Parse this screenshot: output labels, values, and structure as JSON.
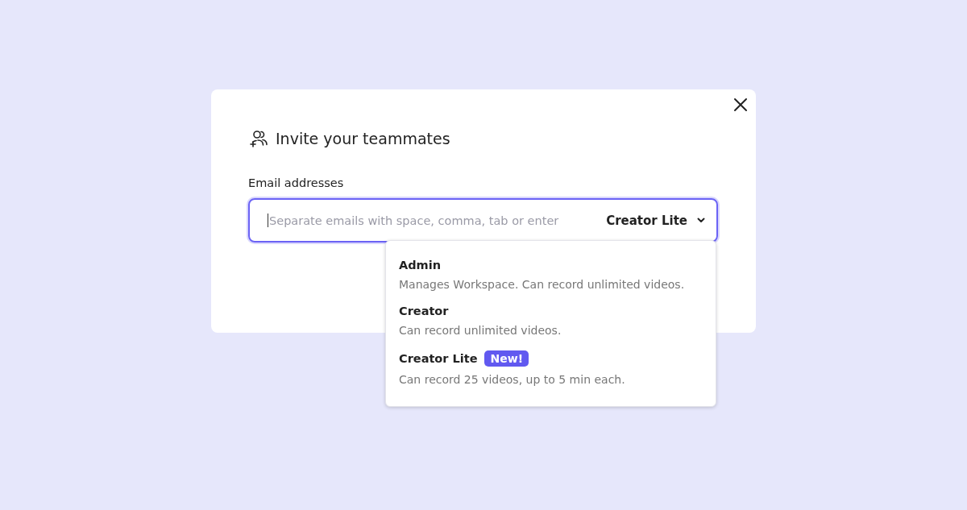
{
  "dialog": {
    "title": "Invite your teammates",
    "field_label": "Email addresses",
    "email_field": {
      "placeholder": "Separate emails with space, comma, tab or enter",
      "focused": true
    },
    "role_select": {
      "value": "Creator Lite",
      "expanded": true
    },
    "role_menu": [
      {
        "name": "Admin",
        "description": "Manages Workspace. Can record unlimited videos."
      },
      {
        "name": "Creator",
        "description": "Can record unlimited videos."
      },
      {
        "name": "Creator Lite",
        "badge": "New!",
        "description": "Can record 25 videos, up to 5 min each."
      }
    ]
  }
}
